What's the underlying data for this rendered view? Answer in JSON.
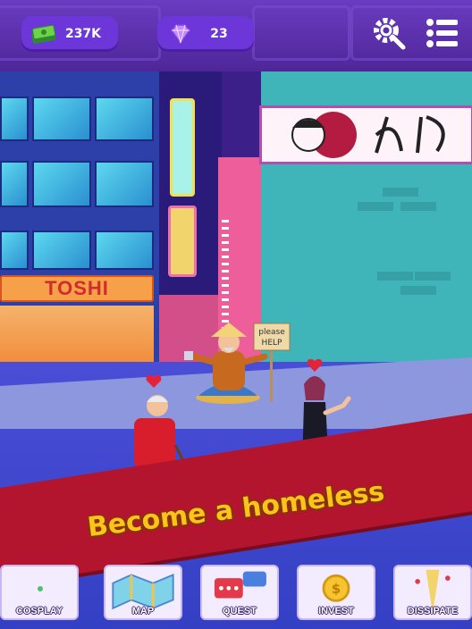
{
  "hud": {
    "cash": {
      "value": "237K",
      "icon": "cash-stack-icon"
    },
    "gems": {
      "value": "23",
      "icon": "diamond-icon"
    },
    "settings_icon": "gear-wrench-icon",
    "menu_icon": "list-menu-icon"
  },
  "scene": {
    "store_sign": "TOSHI",
    "beggar_sign": [
      "please",
      "HELP"
    ],
    "banner": "Become a homeless"
  },
  "tabs": [
    {
      "label": "COSPLAY",
      "icon": "costume-icon"
    },
    {
      "label": "MAP",
      "icon": "map-icon"
    },
    {
      "label": "QUEST",
      "icon": "chat-bubbles-icon"
    },
    {
      "label": "INVEST",
      "icon": "coin-icon"
    },
    {
      "label": "DISSIPATE",
      "icon": "champagne-icon"
    }
  ],
  "colors": {
    "hud_bg": "#5a2fb0",
    "pill": "#6d36d9",
    "banner": "#b3152e",
    "banner_text": "#ffc21a"
  }
}
